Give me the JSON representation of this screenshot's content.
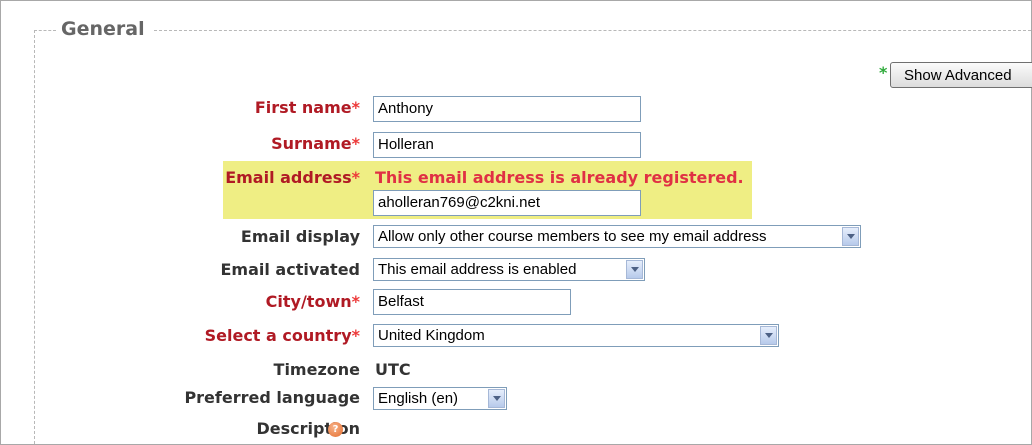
{
  "section": {
    "legend": "General"
  },
  "advanced_button": {
    "asterisk": "*",
    "label": "Show Advanced"
  },
  "form": {
    "required_marker": "*",
    "first_name": {
      "label": "First name",
      "value": "Anthony"
    },
    "surname": {
      "label": "Surname",
      "value": "Holleran"
    },
    "email": {
      "label": "Email address",
      "error": "This email address is already registered.",
      "value": "aholleran769@c2kni.net"
    },
    "email_display": {
      "label": "Email display",
      "selected": "Allow only other course members to see my email address"
    },
    "email_activated": {
      "label": "Email activated",
      "selected": "This email address is enabled"
    },
    "city": {
      "label": "City/town",
      "value": "Belfast"
    },
    "country": {
      "label": "Select a country",
      "selected": "United Kingdom"
    },
    "timezone": {
      "label": "Timezone",
      "value": "UTC"
    },
    "language": {
      "label": "Preferred language",
      "selected": "English (en)"
    },
    "description": {
      "label": "Description"
    }
  },
  "colors": {
    "required_label": "#b01a24",
    "error_text": "#e03044",
    "error_highlight": "#efee84",
    "asterisk": "#ed3a3a"
  },
  "icons": {
    "help": "help-icon",
    "dropdown": "chevron-down-icon"
  }
}
